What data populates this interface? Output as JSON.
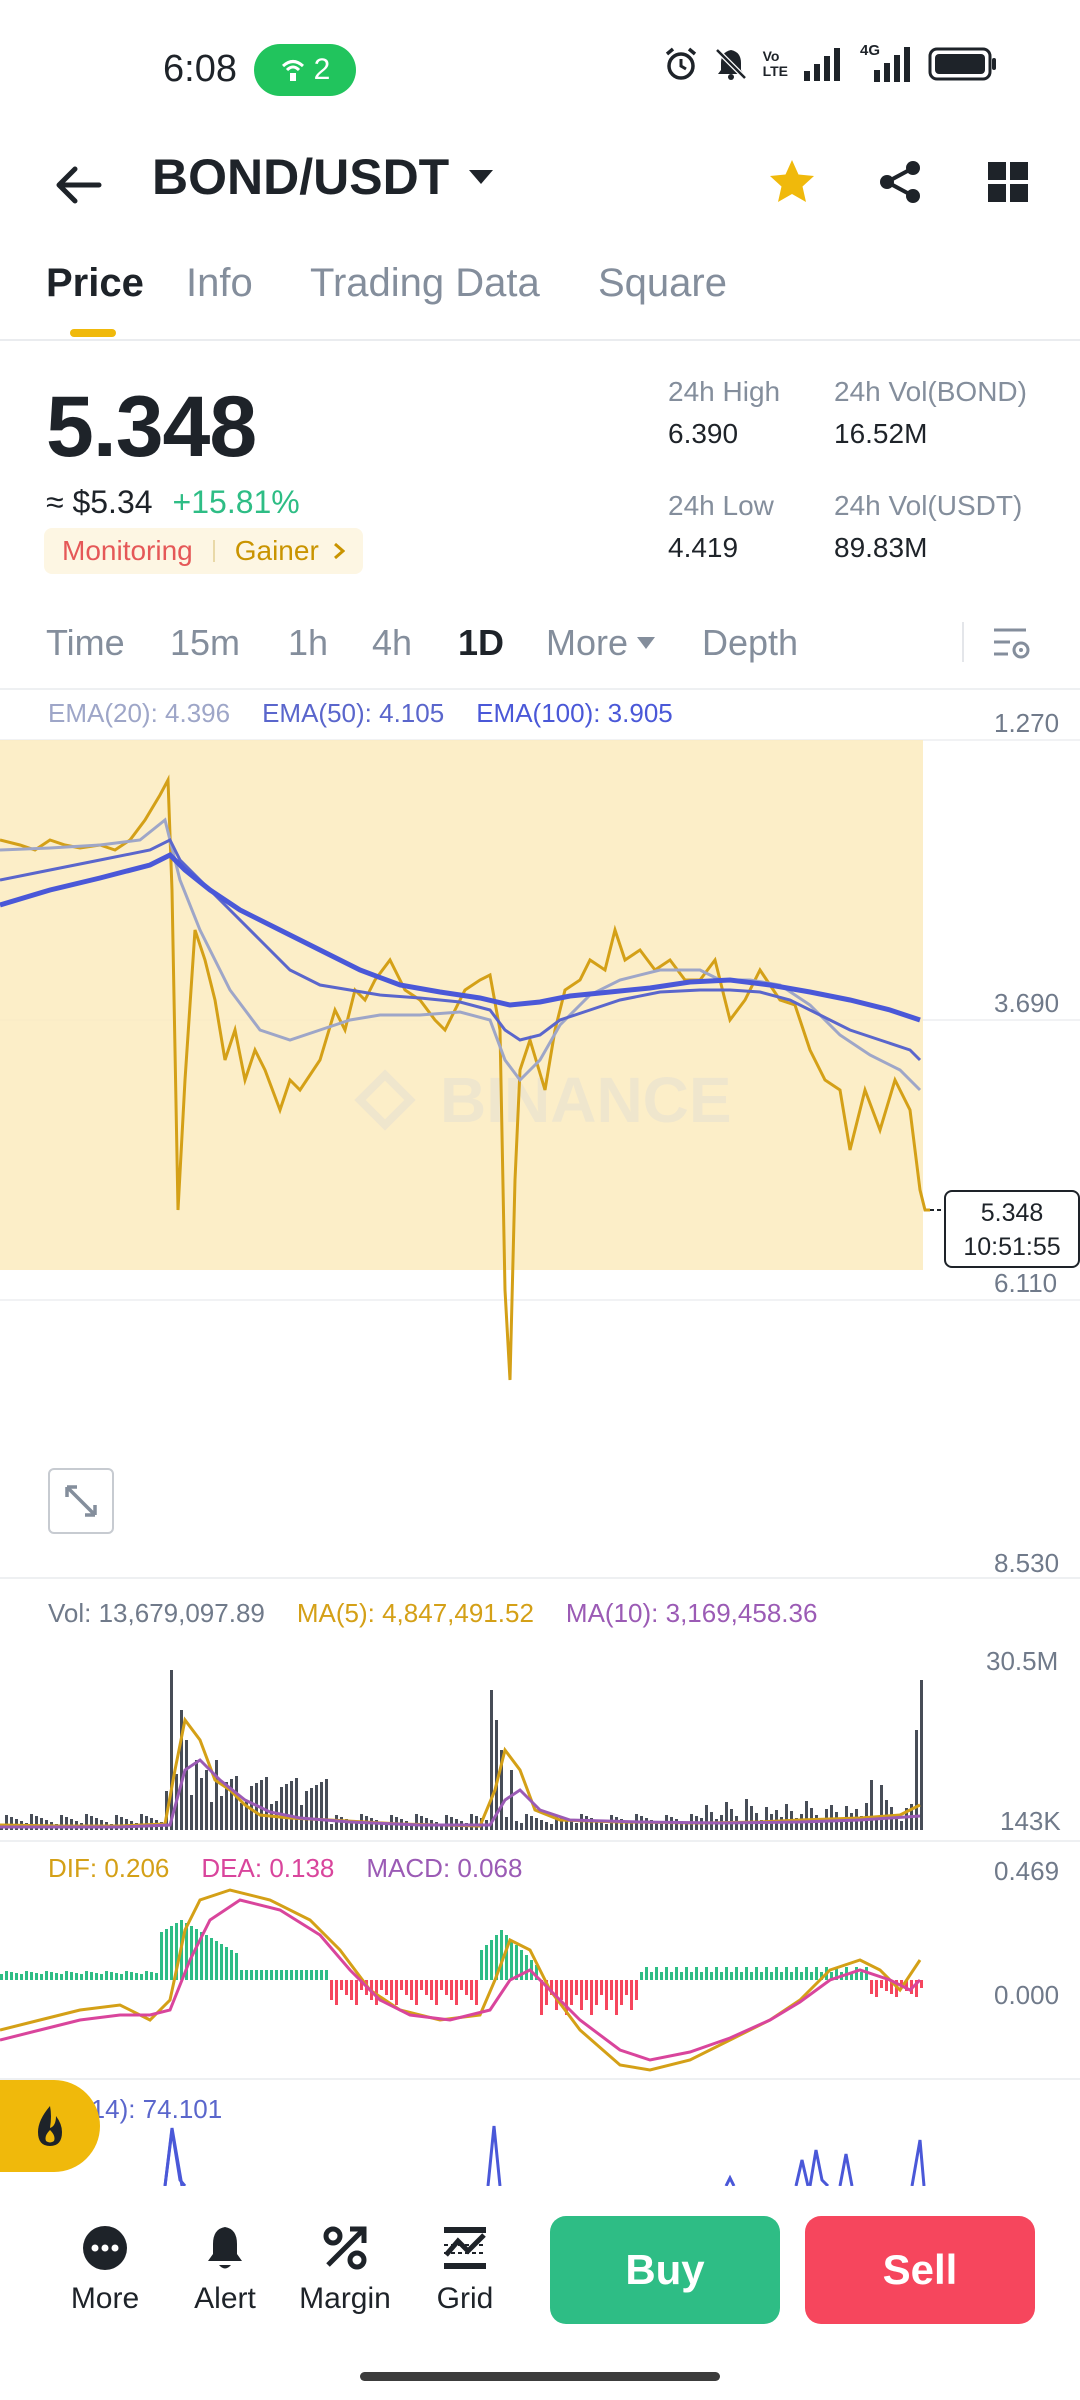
{
  "status_bar": {
    "time": "6:08",
    "hotspot_count": "2",
    "lte_top": "Vo",
    "lte_bottom": "LTE",
    "net_type": "4G"
  },
  "header": {
    "pair": "BOND/USDT"
  },
  "tabs": [
    {
      "label": "Price",
      "active": true
    },
    {
      "label": "Info",
      "active": false
    },
    {
      "label": "Trading Data",
      "active": false
    },
    {
      "label": "Square",
      "active": false
    }
  ],
  "price": {
    "last": "5.348",
    "usd": "≈ $5.34",
    "change": "+15.81%",
    "tag_monitoring": "Monitoring",
    "tag_gainer": "Gainer"
  },
  "stats": {
    "high_label": "24h High",
    "high_value": "6.390",
    "low_label": "24h Low",
    "low_value": "4.419",
    "vol_base_label": "24h Vol(BOND)",
    "vol_base_value": "16.52M",
    "vol_quote_label": "24h Vol(USDT)",
    "vol_quote_value": "89.83M"
  },
  "intervals": [
    {
      "label": "Time",
      "active": false
    },
    {
      "label": "15m",
      "active": false
    },
    {
      "label": "1h",
      "active": false
    },
    {
      "label": "4h",
      "active": false
    },
    {
      "label": "1D",
      "active": true
    },
    {
      "label": "More",
      "active": false
    },
    {
      "label": "Depth",
      "active": false
    }
  ],
  "main_chart": {
    "ema20": "EMA(20): 4.396",
    "ema50": "EMA(50): 4.105",
    "ema100": "EMA(100): 3.905",
    "axis": [
      "1.270",
      "3.690",
      "6.110",
      "8.530"
    ],
    "watermark": "BINANCE",
    "price_tag_value": "5.348",
    "price_tag_countdown": "10:51:55"
  },
  "volume": {
    "vol": "Vol: 13,679,097.89",
    "ma5": "MA(5): 4,847,491.52",
    "ma10": "MA(10): 3,169,458.36",
    "axis_top": "30.5M",
    "axis_bottom": "143K"
  },
  "macd": {
    "dif": "DIF: 0.206",
    "dea": "DEA: 0.138",
    "macd": "MACD: 0.068",
    "axis_top": "0.469",
    "axis_mid": "0.000"
  },
  "rsi": {
    "label": "(14): 74.101"
  },
  "bottom_bar": {
    "more": "More",
    "alert": "Alert",
    "margin": "Margin",
    "grid": "Grid",
    "buy": "Buy",
    "sell": "Sell"
  },
  "colors": {
    "yellow": "#f0b90b",
    "green": "#2ebd85",
    "red": "#f6465d",
    "ema20": "#9ea6c8",
    "ema50": "#5a66cc",
    "ema100": "#4a58d8",
    "ma10": "#9b5bb5",
    "dea": "#d9459c"
  }
}
